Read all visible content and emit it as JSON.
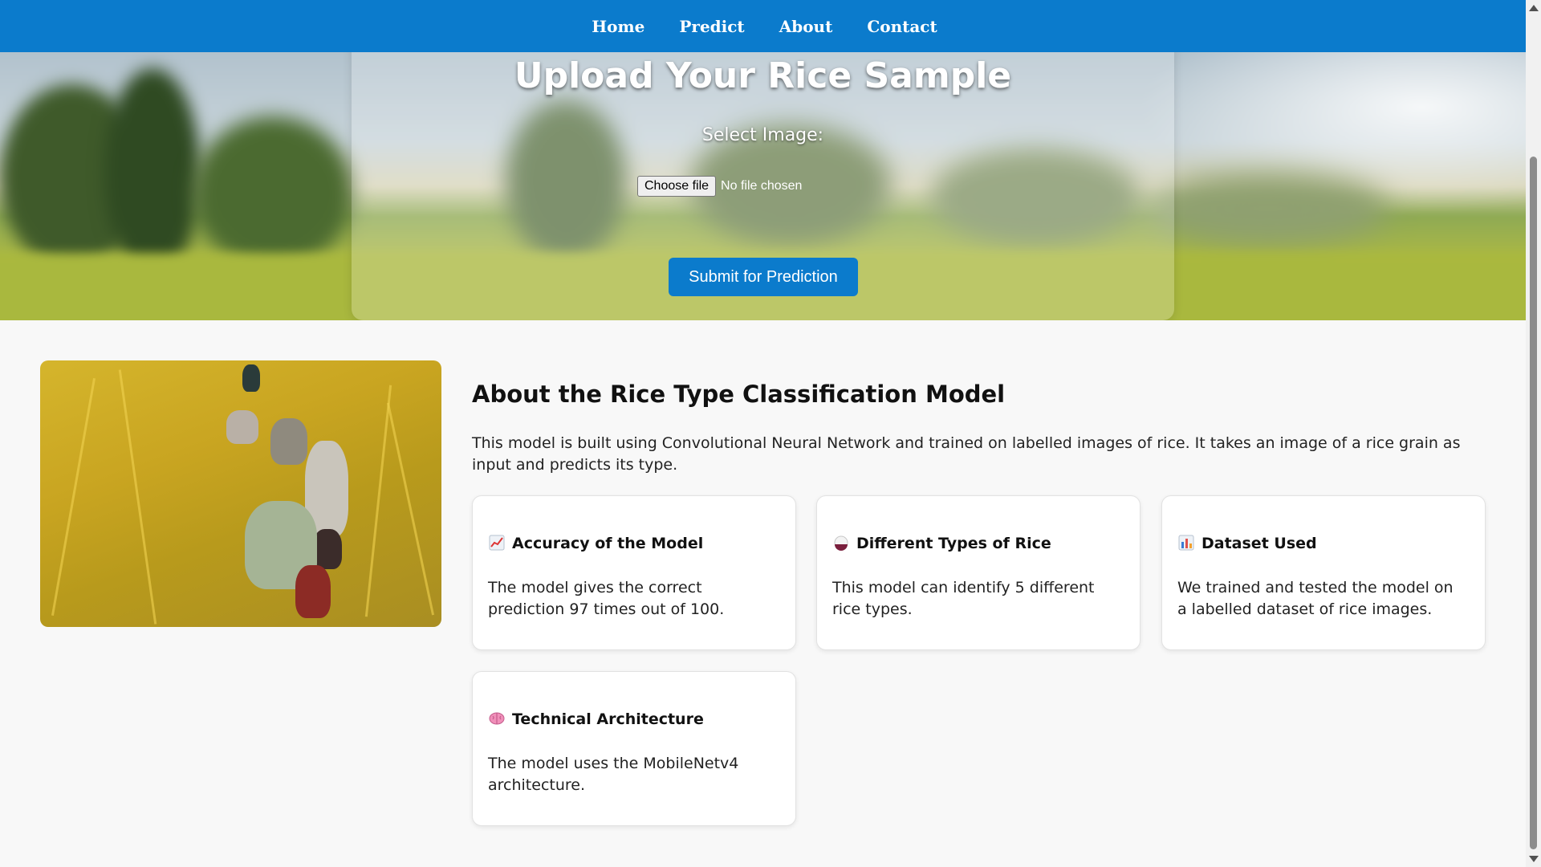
{
  "nav": {
    "items": [
      {
        "label": "Home"
      },
      {
        "label": "Predict"
      },
      {
        "label": "About"
      },
      {
        "label": "Contact"
      }
    ]
  },
  "upload": {
    "title": "Upload Your Rice Sample",
    "select_label": "Select Image:",
    "choose_file_label": "Choose file",
    "file_status": "No file chosen",
    "submit_label": "Submit for Prediction"
  },
  "about": {
    "heading": "About the Rice Type Classification Model",
    "description": "This model is built using Convolutional Neural Network and trained on labelled images of rice. It takes an image of a rice grain as input and predicts its type.",
    "cards": [
      {
        "icon": "chart-increasing-icon",
        "title": "Accuracy of the Model",
        "text": "The model gives the correct prediction 97 times out of 100."
      },
      {
        "icon": "rice-ball-icon",
        "title": "Different Types of Rice",
        "text": "This model can identify 5 different rice types."
      },
      {
        "icon": "bar-chart-icon",
        "title": "Dataset Used",
        "text": "We trained and tested the model on a labelled dataset of rice images."
      },
      {
        "icon": "brain-icon",
        "title": "Technical Architecture",
        "text": "The model uses the MobileNetv4 architecture."
      }
    ]
  },
  "colors": {
    "primary": "#0b7bcc",
    "page_background": "#f8f8f8",
    "card_background": "#ffffff"
  }
}
